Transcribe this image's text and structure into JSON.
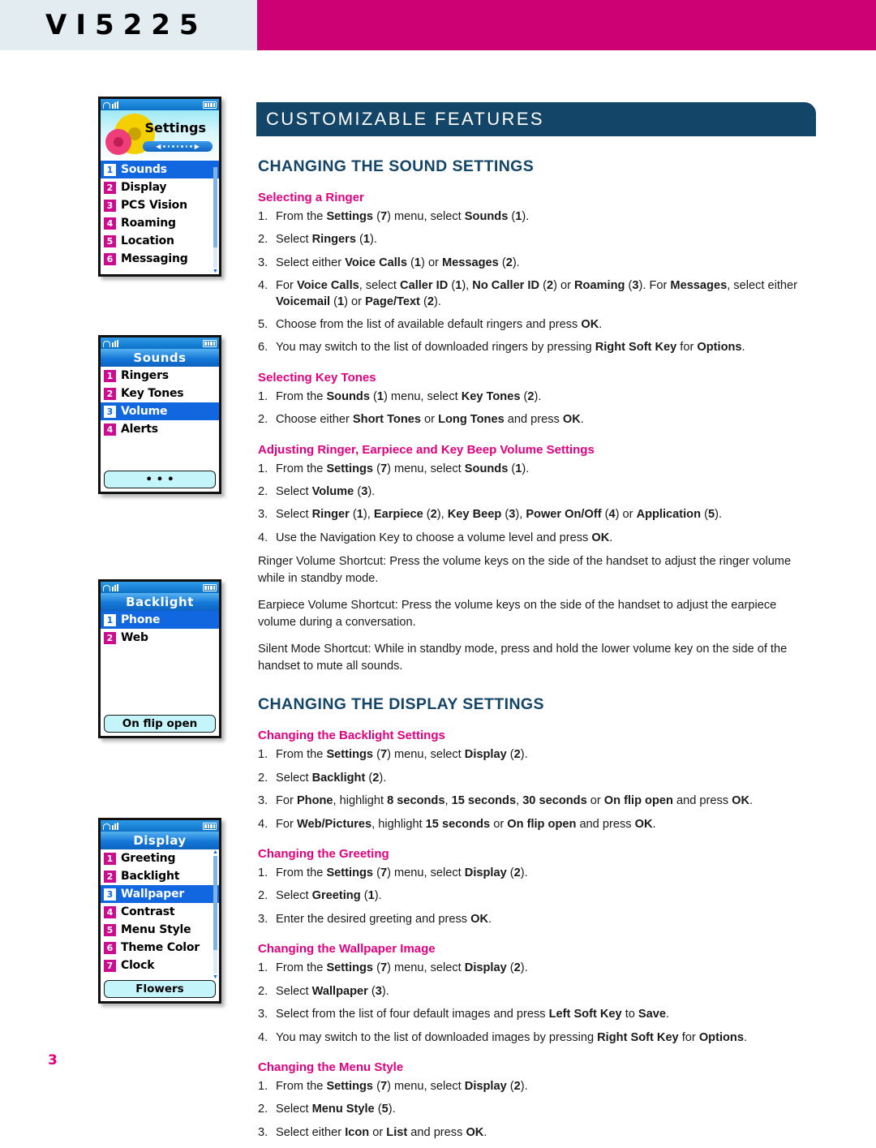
{
  "header": {
    "model": "VI5225",
    "bar_color": "#cd0074",
    "box_color": "#e2ecf1"
  },
  "page_number": "3",
  "banner": {
    "title": "CUSTOMIZABLE FEATURES",
    "color": "#134568"
  },
  "sections": [
    {
      "heading": "CHANGING THE SOUND SETTINGS",
      "subsections": [
        {
          "title": "Selecting a Ringer",
          "steps": [
            "1. From the <b>Settings</b> (<b>7</b>) menu, select <b>Sounds</b> (<b>1</b>).",
            "2. Select <b>Ringers</b> (<b>1</b>).",
            "3. Select either <b>Voice Calls</b> (<b>1</b>) or <b>Messages</b> (<b>2</b>).",
            "4. For <b>Voice Calls</b>, select <b>Caller ID</b> (<b>1</b>), <b>No Caller ID</b> (<b>2</b>) or <b>Roaming</b> (<b>3</b>). For <b>Messages</b>, select either <b>Voicemail</b> (<b>1</b>) or <b>Page/Text</b> (<b>2</b>).",
            "5. Choose from the list of available default ringers and press <b>OK</b>.",
            "6. You may switch to the list of downloaded ringers by pressing <b>Right Soft Key</b> for <b>Options</b>."
          ]
        },
        {
          "title": "Selecting Key Tones",
          "steps": [
            "1. From the <b>Sounds</b> (<b>1</b>) menu, select <b>Key Tones</b> (<b>2</b>).",
            "2. Choose either <b>Short Tones</b> or <b>Long Tones</b> and press <b>OK</b>."
          ]
        },
        {
          "title": "Adjusting Ringer, Earpiece and Key Beep Volume Settings",
          "steps": [
            "1. From the <b>Settings</b> (<b>7</b>) menu, select <b>Sounds</b> (<b>1</b>).",
            "2. Select <b>Volume</b> (<b>3</b>).",
            "3. Select <b>Ringer</b> (<b>1</b>), <b>Earpiece</b> (<b>2</b>), <b>Key Beep</b> (<b>3</b>), <b>Power On/Off</b> (<b>4</b>) or <b>Application</b> (<b>5</b>).",
            "4. Use the Navigation Key to choose a volume level and press <b>OK</b>."
          ],
          "paragraphs": [
            "Ringer Volume Shortcut: Press the volume keys on the side of the handset to adjust the ringer volume while in standby mode.",
            "Earpiece Volume Shortcut: Press the volume keys on the side of the handset to adjust the earpiece volume during a conversation.",
            "Silent Mode Shortcut: While in standby mode, press and hold the lower volume key on the side of the handset to mute all sounds."
          ]
        }
      ]
    },
    {
      "heading": "CHANGING THE DISPLAY SETTINGS",
      "subsections": [
        {
          "title": "Changing the Backlight Settings",
          "steps": [
            "1. From the <b>Settings</b> (<b>7</b>) menu, select <b>Display</b> (<b>2</b>).",
            "2. Select <b>Backlight</b> (<b>2</b>).",
            "3. For <b>Phone</b>, highlight <b>8 seconds</b>, <b>15 seconds</b>, <b>30 seconds</b> or <b>On flip open</b> and press <b>OK</b>.",
            "4. For <b>Web/Pictures</b>, highlight <b>15 seconds</b> or <b>On flip open</b> and press <b>OK</b>."
          ]
        },
        {
          "title": "Changing the Greeting",
          "steps": [
            "1. From the <b>Settings</b> (<b>7</b>) menu, select <b>Display</b> (<b>2</b>).",
            "2. Select <b>Greeting</b> (<b>1</b>).",
            "3. Enter the desired greeting and press <b>OK</b>."
          ]
        },
        {
          "title": "Changing the Wallpaper Image",
          "steps": [
            "1. From the <b>Settings</b> (<b>7</b>) menu, select <b>Display</b> (<b>2</b>).",
            "2. Select <b>Wallpaper</b> (<b>3</b>).",
            "3. Select from the list of four default images and press <b>Left Soft Key</b> to <b>Save</b>.",
            "4. You may switch to the list of downloaded images by pressing <b>Right Soft Key</b> for <b>Options</b>."
          ]
        },
        {
          "title": "Changing the Menu Style",
          "steps": [
            "1. From the <b>Settings</b> (<b>7</b>) menu, select <b>Display</b> (<b>2</b>).",
            "2. Select <b>Menu Style</b> (<b>5</b>).",
            "3. Select either <b>Icon</b> or <b>List</b> and press <b>OK</b>."
          ]
        }
      ]
    }
  ],
  "phone_screens": [
    {
      "name": "settings",
      "header_type": "icon",
      "title": "Settings",
      "icon": "gears-icon",
      "items": [
        {
          "num": "1",
          "label": "Sounds",
          "selected": true
        },
        {
          "num": "2",
          "label": "Display",
          "selected": false
        },
        {
          "num": "3",
          "label": "PCS Vision",
          "selected": false
        },
        {
          "num": "4",
          "label": "Roaming",
          "selected": false
        },
        {
          "num": "5",
          "label": "Location",
          "selected": false
        },
        {
          "num": "6",
          "label": "Messaging",
          "selected": false
        }
      ],
      "scrollbar": true,
      "softkey": null
    },
    {
      "name": "sounds",
      "header_type": "title",
      "title": "Sounds",
      "items": [
        {
          "num": "1",
          "label": "Ringers",
          "selected": false
        },
        {
          "num": "2",
          "label": "Key Tones",
          "selected": false
        },
        {
          "num": "3",
          "label": "Volume",
          "selected": true
        },
        {
          "num": "4",
          "label": "Alerts",
          "selected": false
        }
      ],
      "scrollbar": false,
      "softkey": "• • •"
    },
    {
      "name": "backlight",
      "header_type": "title",
      "title": "Backlight",
      "items": [
        {
          "num": "1",
          "label": "Phone",
          "selected": true
        },
        {
          "num": "2",
          "label": "Web",
          "selected": false
        }
      ],
      "scrollbar": false,
      "softkey": "On flip open"
    },
    {
      "name": "display",
      "header_type": "title",
      "title": "Display",
      "items": [
        {
          "num": "1",
          "label": "Greeting",
          "selected": false
        },
        {
          "num": "2",
          "label": "Backlight",
          "selected": false
        },
        {
          "num": "3",
          "label": "Wallpaper",
          "selected": true
        },
        {
          "num": "4",
          "label": "Contrast",
          "selected": false
        },
        {
          "num": "5",
          "label": "Menu Style",
          "selected": false
        },
        {
          "num": "6",
          "label": "Theme Color",
          "selected": false
        },
        {
          "num": "7",
          "label": "Clock",
          "selected": false
        }
      ],
      "scrollbar": true,
      "softkey": "Flowers"
    }
  ],
  "colors": {
    "brand_magenta": "#cd0074",
    "navy": "#134568",
    "subheading_pink": "#e3007f",
    "phone_select_blue": "#1167e0",
    "badge_magenta": "#cc0b8f",
    "softkey_cyan": "#c4f5fa"
  }
}
